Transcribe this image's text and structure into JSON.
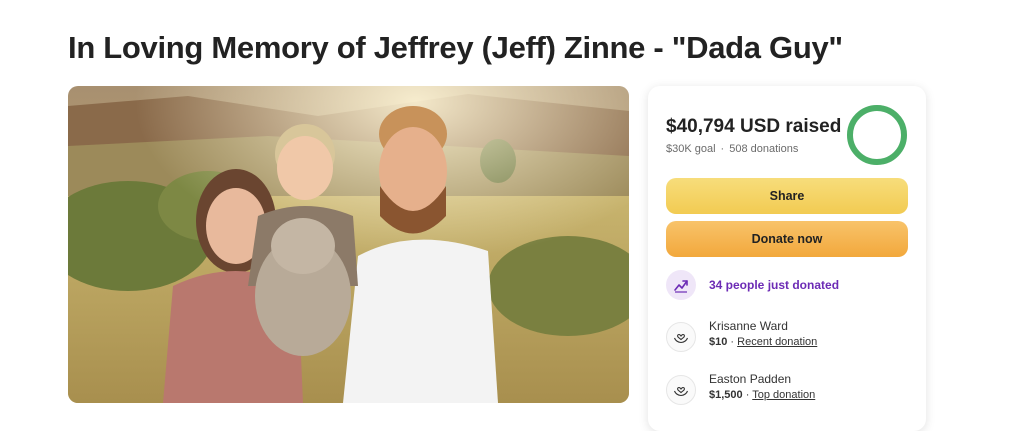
{
  "page": {
    "title": "In Loving Memory of Jeffrey (Jeff) Zinne - \"Dada Guy\""
  },
  "photo": {
    "alt": "Family photo"
  },
  "fundraiser": {
    "raised_amount": "$40,794",
    "raised_suffix": "USD raised",
    "goal": "$30K goal",
    "separator": "·",
    "donations": "508 donations",
    "progress_fraction": 1.0,
    "progress_color": "#4caf68",
    "share_label": "Share",
    "donate_label": "Donate now",
    "recent_activity": "34 people just donated",
    "recent_icon": "trending-up-icon"
  },
  "donors": [
    {
      "name": "Krisanne Ward",
      "amount": "$10",
      "separator": "·",
      "type": "Recent donation",
      "icon": "heart-hands-icon"
    },
    {
      "name": "Easton Padden",
      "amount": "$1,500",
      "separator": "·",
      "type": "Top donation",
      "icon": "heart-hands-icon"
    }
  ],
  "colors": {
    "share_button": "#f2cb52",
    "donate_button": "#f2a83c",
    "recent_text": "#6c2bb5"
  }
}
